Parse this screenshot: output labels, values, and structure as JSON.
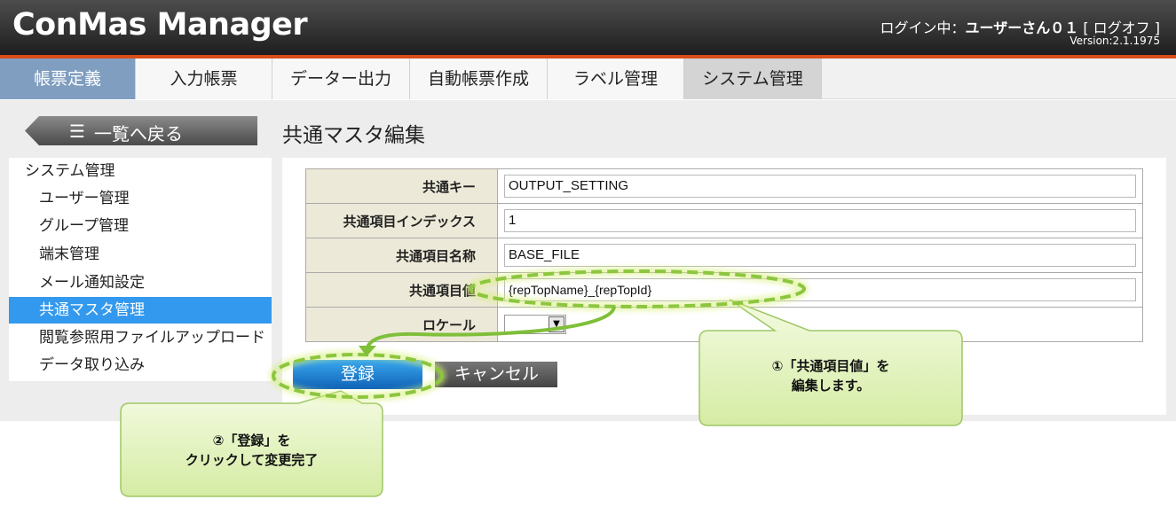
{
  "header": {
    "app_title": "ConMas Manager",
    "login_prefix": "ログイン中：",
    "login_user": "ユーザーさん０１",
    "logoff": "[ ログオフ ]",
    "version": "Version:2.1.1975"
  },
  "nav": {
    "tabs": [
      {
        "label": "帳票定義"
      },
      {
        "label": "入力帳票"
      },
      {
        "label": "データー出力"
      },
      {
        "label": "自動帳票作成"
      },
      {
        "label": "ラベル管理"
      },
      {
        "label": "システム管理"
      }
    ]
  },
  "back_button": {
    "label": "一覧へ戻る"
  },
  "page_title": "共通マスタ編集",
  "sidebar": {
    "items": [
      {
        "label": "システム管理"
      },
      {
        "label": "ユーザー管理"
      },
      {
        "label": "グループ管理"
      },
      {
        "label": "端末管理"
      },
      {
        "label": "メール通知設定"
      },
      {
        "label": "共通マスタ管理"
      },
      {
        "label": "閲覧参照用ファイルアップロード"
      },
      {
        "label": "データ取り込み"
      }
    ]
  },
  "form": {
    "fields": [
      {
        "label": "共通キー",
        "value": "OUTPUT_SETTING"
      },
      {
        "label": "共通項目インデックス",
        "value": "1"
      },
      {
        "label": "共通項目名称",
        "value": "BASE_FILE"
      },
      {
        "label": "共通項目値",
        "value": "{repTopName}_{repTopId}"
      },
      {
        "label": "ロケール",
        "value": ""
      }
    ],
    "register_label": "登録",
    "cancel_label": "キャンセル"
  },
  "callouts": {
    "edit_line1": "①「共通項目値」を",
    "edit_line2": "編集します。",
    "register_line1": "②「登録」を",
    "register_line2": "クリックして変更完了"
  },
  "colors": {
    "accent_stripe": "#d84d1a",
    "active_tab": "#7f9ec0",
    "sidebar_active": "#3399ee",
    "callout_fill": "#e3f4bd",
    "highlight_dash": "#8cc63f"
  }
}
